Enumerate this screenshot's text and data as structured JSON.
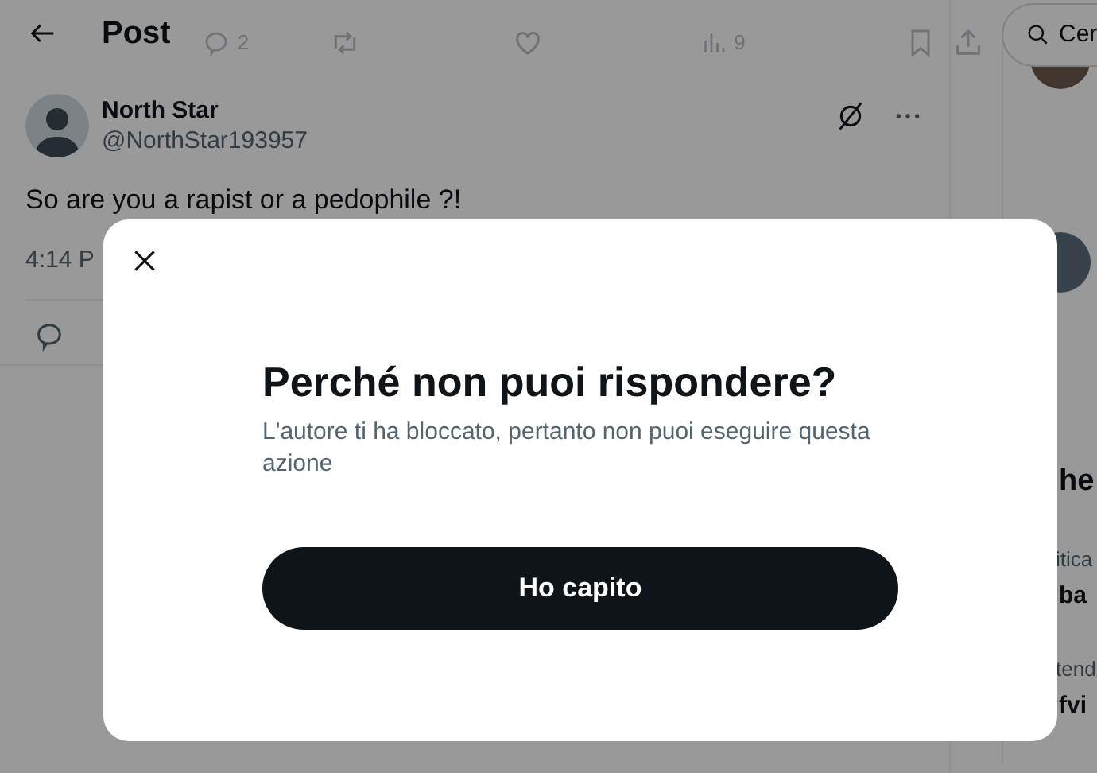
{
  "header": {
    "title": "Post"
  },
  "previous_post": {
    "reply_count": "2",
    "view_count": "9"
  },
  "post": {
    "author_name": "North Star",
    "author_handle": "@NorthStar193957",
    "text": "So are you a rapist or a pedophile ?!",
    "time": "4:14 P"
  },
  "sidebar": {
    "search": {
      "placeholder": "Cer"
    },
    "heading": "he",
    "items": [
      {
        "context": "itica",
        "title": "ba"
      },
      {
        "context": "tend",
        "title": "fvi"
      }
    ]
  },
  "dialog": {
    "title": "Perché non puoi rispondere?",
    "message": "L'autore ti ha bloccato, pertanto non puoi eseguire questa azione",
    "button": "Ho capito"
  }
}
